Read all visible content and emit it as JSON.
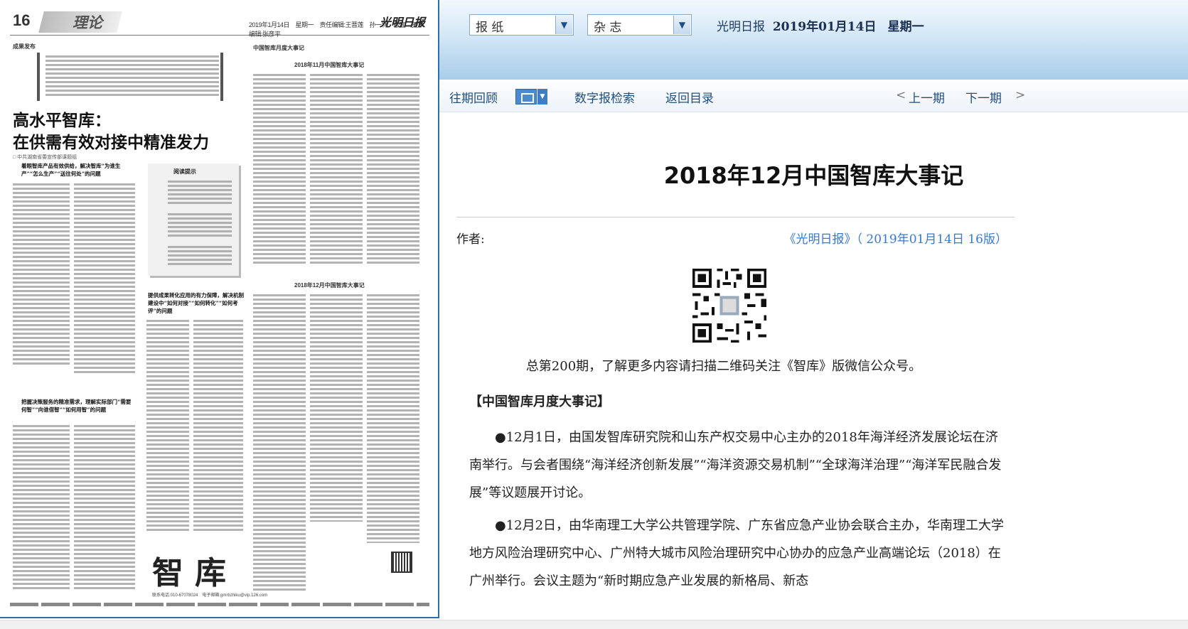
{
  "left_page": {
    "page_number": "16",
    "section": "理论",
    "header_date": "2019年1月14日　星期一　责任编辑:王晋莲　孙一林　版面　美术编辑:张彦平",
    "masthead": "光明日报",
    "kicker_left": "成果发布",
    "headline_line1": "高水平智库：",
    "headline_line2": "在供需有效对接中精准发力",
    "byline": "□ 中共湖南省委宣传部课题组",
    "subhead1": "着眼智库产品有效供给，解决智库“为谁生产”“怎么生产”“送往何处”的问题",
    "tip_title": "阅读提示",
    "subhead2": "提供成果转化应用的有力保障，解决机制建设中“如何对接”“如何转化”“如何考评”的问题",
    "subhead3": "把握决策服务的精准需求，理解实际部门“需要何智”“向谁借智”“如何用智”的问题",
    "kicker_right": "中国智库月度大事记",
    "sect_nov": "2018年11月中国智库大事记",
    "sect_dec": "2018年12月中国智库大事记",
    "zhiku": "智库",
    "zhiku_info": "联系电话:010-67078024　电子邮箱:gmrbzhiku@vip.126.com"
  },
  "top_bar": {
    "select_newspaper": "报 纸",
    "select_magazine": "杂 志",
    "paper_name": "光明日报",
    "date": "2019年01月14日",
    "weekday": "星期一"
  },
  "nav": {
    "past_issues": "往期回顾",
    "digital_search": "数字报检索",
    "back_to_index": "返回目录",
    "prev_issue": "上一期",
    "next_issue": "下一期",
    "prev_symbol": "<",
    "next_symbol": ">"
  },
  "article": {
    "title": "2018年12月中国智库大事记",
    "author_label": "作者:",
    "source": "《光明日报》（ 2019年01月14日 16版）",
    "qr_caption": "总第200期，了解更多内容请扫描二维码关注《智库》版微信公众号。",
    "section_heading": "【中国智库月度大事记】",
    "paragraph1": "●12月1日，由国发智库研究院和山东产权交易中心主办的2018年海洋经济发展论坛在济南举行。与会者围绕“海洋经济创新发展”“海洋资源交易机制”“全球海洋治理”“海洋军民融合发展”等议题展开讨论。",
    "paragraph2": "●12月2日，由华南理工大学公共管理学院、广东省应急产业协会联合主办，华南理工大学地方风险治理研究中心、广州特大城市风险治理研究中心协办的应急产业高端论坛（2018）在广州举行。会议主题为“新时期应急产业发展的新格局、新态"
  },
  "colors": {
    "accent_blue": "#3a79c9",
    "nav_text": "#20507f",
    "page_border": "#2a6fb0"
  }
}
